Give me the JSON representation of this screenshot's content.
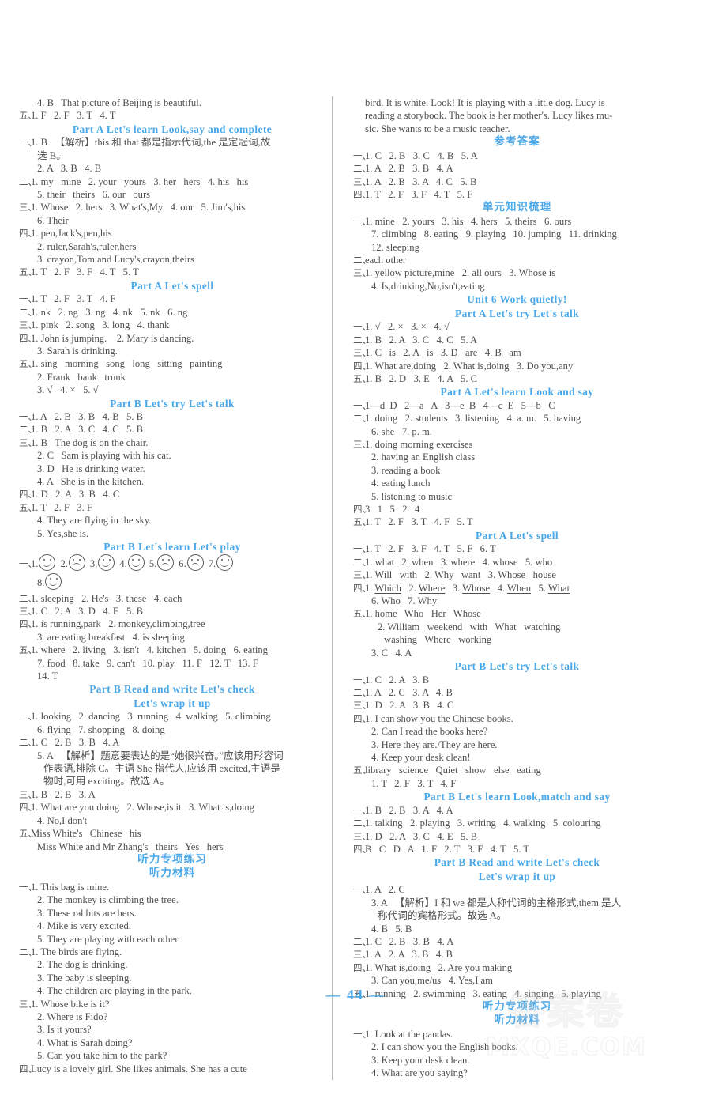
{
  "page": {
    "number": "— 44 —",
    "watermark_cn": "答案卷",
    "watermark_en": "MXQE.COM"
  },
  "left_column": [
    {
      "type": "text",
      "marker": "",
      "text": "4. B   That picture of Beijing is beautiful.",
      "indent": 1
    },
    {
      "type": "text",
      "marker": "五、",
      "text": "1. F   2. F   3. T   4. T"
    },
    {
      "type": "header",
      "text": "Part A   Let's learn   Look,say and complete"
    },
    {
      "type": "text",
      "marker": "一、",
      "text": "1. B   【解析】this 和 that 都是指示代词,the 是定冠词,故"
    },
    {
      "type": "text",
      "marker": "",
      "text": "选 B。",
      "indent": 1
    },
    {
      "type": "text",
      "marker": "",
      "text": "2. A   3. B   4. B",
      "indent": 1
    },
    {
      "type": "text",
      "marker": "二、",
      "text": "1. my   mine   2. your   yours   3. her   hers   4. his   his"
    },
    {
      "type": "text",
      "marker": "",
      "text": "5. their   theirs   6. our   ours",
      "indent": 1
    },
    {
      "type": "text",
      "marker": "三、",
      "text": "1. Whose   2. hers   3. What's,My   4. our   5. Jim's,his"
    },
    {
      "type": "text",
      "marker": "",
      "text": "6. Their",
      "indent": 1
    },
    {
      "type": "text",
      "marker": "四、",
      "text": "1. pen,Jack's,pen,his"
    },
    {
      "type": "text",
      "marker": "",
      "text": "2. ruler,Sarah's,ruler,hers",
      "indent": 1
    },
    {
      "type": "text",
      "marker": "",
      "text": "3. crayon,Tom and Lucy's,crayon,theirs",
      "indent": 1
    },
    {
      "type": "text",
      "marker": "五、",
      "text": "1. T   2. F   3. F   4. T   5. T"
    },
    {
      "type": "header",
      "text": "Part A   Let's spell"
    },
    {
      "type": "text",
      "marker": "一、",
      "text": "1. T   2. F   3. T   4. F"
    },
    {
      "type": "text",
      "marker": "二、",
      "text": "1. nk   2. ng   3. ng   4. nk   5. nk   6. ng"
    },
    {
      "type": "text",
      "marker": "三、",
      "text": "1. pink   2. song   3. long   4. thank"
    },
    {
      "type": "text",
      "marker": "四、",
      "text": "1. John is jumping.    2. Mary is dancing."
    },
    {
      "type": "text",
      "marker": "",
      "text": "3. Sarah is drinking.",
      "indent": 1
    },
    {
      "type": "text",
      "marker": "五、",
      "text": "1. sing   morning   song   long   sitting   painting"
    },
    {
      "type": "text",
      "marker": "",
      "text": "2. Frank   bank   trunk",
      "indent": 1
    },
    {
      "type": "text",
      "marker": "",
      "text": "3. √   4. ×   5. √",
      "indent": 1
    },
    {
      "type": "header",
      "text": "Part B   Let's try   Let's talk"
    },
    {
      "type": "text",
      "marker": "一、",
      "text": "1. A   2. B   3. B   4. B   5. B"
    },
    {
      "type": "text",
      "marker": "二、",
      "text": "1. B   2. A   3. C   4. C   5. B"
    },
    {
      "type": "text",
      "marker": "三、",
      "text": "1. B   The dog is on the chair."
    },
    {
      "type": "text",
      "marker": "",
      "text": "2. C   Sam is playing with his cat.",
      "indent": 1
    },
    {
      "type": "text",
      "marker": "",
      "text": "3. D   He is drinking water.",
      "indent": 1
    },
    {
      "type": "text",
      "marker": "",
      "text": "4. A   She is in the kitchen.",
      "indent": 1
    },
    {
      "type": "text",
      "marker": "四、",
      "text": "1. D   2. A   3. B   4. C"
    },
    {
      "type": "text",
      "marker": "五、",
      "text": "1. T   2. F   3. F"
    },
    {
      "type": "text",
      "marker": "",
      "text": "4. They are flying in the sky.",
      "indent": 1
    },
    {
      "type": "text",
      "marker": "",
      "text": "5. Yes,she is.",
      "indent": 1
    },
    {
      "type": "header",
      "text": "Part B   Let's learn   Let's play"
    },
    {
      "type": "faces",
      "marker": "一、",
      "items": [
        {
          "n": "1.",
          "mood": "happy"
        },
        {
          "n": "2.",
          "mood": "sad"
        },
        {
          "n": "3.",
          "mood": "happy"
        },
        {
          "n": "4.",
          "mood": "happy"
        },
        {
          "n": "5.",
          "mood": "sad"
        },
        {
          "n": "6.",
          "mood": "sad"
        },
        {
          "n": "7.",
          "mood": "happy"
        }
      ]
    },
    {
      "type": "faces",
      "marker": "",
      "indent": 1,
      "items": [
        {
          "n": "8.",
          "mood": "happy"
        }
      ]
    },
    {
      "type": "text",
      "marker": "二、",
      "text": "1. sleeping   2. He's   3. these   4. each"
    },
    {
      "type": "text",
      "marker": "三、",
      "text": "1. C   2. A   3. D   4. E   5. B"
    },
    {
      "type": "text",
      "marker": "四、",
      "text": "1. is running,park   2. monkey,climbing,tree"
    },
    {
      "type": "text",
      "marker": "",
      "text": "3. are eating breakfast   4. is sleeping",
      "indent": 1
    },
    {
      "type": "text",
      "marker": "五、",
      "text": "1. where   2. living   3. isn't   4. kitchen   5. doing   6. eating"
    },
    {
      "type": "text",
      "marker": "",
      "text": "7. food   8. take   9. can't   10. play   11. F   12. T   13. F",
      "indent": 1
    },
    {
      "type": "text",
      "marker": "",
      "text": "14. T",
      "indent": 1
    },
    {
      "type": "header",
      "text": "Part B   Read and write   Let's check"
    },
    {
      "type": "header",
      "text": "Let's wrap it up"
    },
    {
      "type": "text",
      "marker": "一、",
      "text": "1. looking   2. dancing   3. running   4. walking   5. climbing"
    },
    {
      "type": "text",
      "marker": "",
      "text": "6. flying   7. shopping   8. doing",
      "indent": 1
    },
    {
      "type": "text",
      "marker": "二、",
      "text": "1. C   2. B   3. B   4. A"
    },
    {
      "type": "text",
      "marker": "",
      "text": "5. A   【解析】题意要表达的是“她很兴奋。”应该用形容词",
      "indent": 1
    },
    {
      "type": "text",
      "marker": "",
      "text": "作表语,排除 C。主语 She 指代人,应该用 excited,主语是",
      "indent": 2
    },
    {
      "type": "text",
      "marker": "",
      "text": "物时,可用 exciting。故选 A。",
      "indent": 2
    },
    {
      "type": "text",
      "marker": "三、",
      "text": "1. B   2. B   3. A"
    },
    {
      "type": "text",
      "marker": "四、",
      "text": "1. What are you doing   2. Whose,is it   3. What is,doing"
    },
    {
      "type": "text",
      "marker": "",
      "text": "4. No,I don't",
      "indent": 1
    },
    {
      "type": "text",
      "marker": "五、",
      "text": "Miss White's   Chinese   his"
    },
    {
      "type": "text",
      "marker": "",
      "text": "Miss White and Mr Zhang's   theirs   Yes   hers",
      "indent": 1
    },
    {
      "type": "header",
      "cn": true,
      "text": "听力专项练习"
    },
    {
      "type": "header",
      "cn": true,
      "text": "听力材料"
    },
    {
      "type": "text",
      "marker": "一、",
      "text": "1. This bag is mine."
    },
    {
      "type": "text",
      "marker": "",
      "text": "2. The monkey is climbing the tree.",
      "indent": 1
    },
    {
      "type": "text",
      "marker": "",
      "text": "3. These rabbits are hers.",
      "indent": 1
    },
    {
      "type": "text",
      "marker": "",
      "text": "4. Mike is very excited.",
      "indent": 1
    },
    {
      "type": "text",
      "marker": "",
      "text": "5. They are playing with each other.",
      "indent": 1
    },
    {
      "type": "text",
      "marker": "二、",
      "text": "1. The birds are flying."
    },
    {
      "type": "text",
      "marker": "",
      "text": "2. The dog is drinking.",
      "indent": 1
    },
    {
      "type": "text",
      "marker": "",
      "text": "3. The baby is sleeping.",
      "indent": 1
    },
    {
      "type": "text",
      "marker": "",
      "text": "4. The children are playing in the park.",
      "indent": 1
    },
    {
      "type": "text",
      "marker": "三、",
      "text": "1. Whose bike is it?"
    },
    {
      "type": "text",
      "marker": "",
      "text": "2. Where is Fido?",
      "indent": 1
    },
    {
      "type": "text",
      "marker": "",
      "text": "3. Is it yours?",
      "indent": 1
    },
    {
      "type": "text",
      "marker": "",
      "text": "4. What is Sarah doing?",
      "indent": 1
    },
    {
      "type": "text",
      "marker": "",
      "text": "5. Can you take him to the park?",
      "indent": 1
    },
    {
      "type": "para",
      "marker": "四、",
      "text": "Lucy is a lovely girl. She likes animals. She has a cute"
    }
  ],
  "right_column": [
    {
      "type": "text",
      "marker": "",
      "text": "bird. It is white. Look! It is playing with a little dog. Lucy is"
    },
    {
      "type": "text",
      "marker": "",
      "text": "reading a storybook. The book is her mother's. Lucy likes mu-"
    },
    {
      "type": "text",
      "marker": "",
      "text": "sic. She wants to be a music teacher."
    },
    {
      "type": "header",
      "cn": true,
      "text": "参考答案"
    },
    {
      "type": "text",
      "marker": "一、",
      "text": "1. C   2. B   3. C   4. B   5. A"
    },
    {
      "type": "text",
      "marker": "二、",
      "text": "1. A   2. B   3. B   4. A"
    },
    {
      "type": "text",
      "marker": "三、",
      "text": "1. A   2. B   3. A   4. C   5. B"
    },
    {
      "type": "text",
      "marker": "四、",
      "text": "1. T   2. F   3. F   4. T   5. F"
    },
    {
      "type": "header",
      "cn": true,
      "text": "单元知识梳理"
    },
    {
      "type": "text",
      "marker": "一、",
      "text": "1. mine   2. yours   3. his   4. hers   5. theirs   6. ours"
    },
    {
      "type": "text",
      "marker": "",
      "text": "7. climbing   8. eating   9. playing   10. jumping   11. drinking",
      "indent": 1
    },
    {
      "type": "text",
      "marker": "",
      "text": "12. sleeping",
      "indent": 1
    },
    {
      "type": "text",
      "marker": "二、",
      "text": "each other"
    },
    {
      "type": "text",
      "marker": "三、",
      "text": "1. yellow picture,mine   2. all ours   3. Whose is"
    },
    {
      "type": "text",
      "marker": "",
      "text": "4. Is,drinking,No,isn't,eating",
      "indent": 1
    },
    {
      "type": "header",
      "text": "Unit 6   Work quietly!"
    },
    {
      "type": "header",
      "text": "Part A   Let's try   Let's talk"
    },
    {
      "type": "text",
      "marker": "一、",
      "text": "1. √   2. ×   3. ×   4. √"
    },
    {
      "type": "text",
      "marker": "二、",
      "text": "1. B   2. A   3. C   4. C   5. A"
    },
    {
      "type": "text",
      "marker": "三、",
      "text": "1. C   is   2. A   is   3. D   are   4. B   am"
    },
    {
      "type": "text",
      "marker": "四、",
      "text": "1. What are,doing   2. What is,doing   3. Do you,any"
    },
    {
      "type": "text",
      "marker": "五、",
      "text": "1. B   2. D   3. E   4. A   5. C"
    },
    {
      "type": "header",
      "text": "Part A   Let's learn   Look and say"
    },
    {
      "type": "text",
      "marker": "一、",
      "text": "1—d  D   2—a   A   3—e  B   4—c  E   5—b   C"
    },
    {
      "type": "text",
      "marker": "二、",
      "text": "1. doing   2. students   3. listening   4. a. m.   5. having"
    },
    {
      "type": "text",
      "marker": "",
      "text": "6. she   7. p. m.",
      "indent": 1
    },
    {
      "type": "text",
      "marker": "三、",
      "text": "1. doing morning exercises"
    },
    {
      "type": "text",
      "marker": "",
      "text": "2. having an English class",
      "indent": 1
    },
    {
      "type": "text",
      "marker": "",
      "text": "3. reading a book",
      "indent": 1
    },
    {
      "type": "text",
      "marker": "",
      "text": "4. eating lunch",
      "indent": 1
    },
    {
      "type": "text",
      "marker": "",
      "text": "5. listening to music",
      "indent": 1
    },
    {
      "type": "text",
      "marker": "四、",
      "text": "3   1   5   2   4"
    },
    {
      "type": "text",
      "marker": "五、",
      "text": "1. T   2. F   3. T   4. F   5. T"
    },
    {
      "type": "header",
      "text": "Part A   Let's spell"
    },
    {
      "type": "text",
      "marker": "一、",
      "text": "1. T   2. F   3. F   4. T   5. F   6. T"
    },
    {
      "type": "text",
      "marker": "二、",
      "text": "1. what   2. when   3. where   4. whose   5. who"
    },
    {
      "type": "html",
      "marker": "三、",
      "text": "1. <u>Will</u>   <u>with</u>   2. <u>Why</u>   <u>want</u>   3. <u>Whose</u>   <u>house</u>"
    },
    {
      "type": "html",
      "marker": "四、",
      "text": "1. <u>Which</u>   2. <u>Where</u>   3. <u>Whose</u>   4. <u>When</u>   5. <u>What</u>"
    },
    {
      "type": "html",
      "marker": "",
      "text": "6. <u>Who</u>   7. <u>Why</u>",
      "indent": 1
    },
    {
      "type": "text",
      "marker": "五、",
      "text": "1. home   Who   Her   Whose"
    },
    {
      "type": "text",
      "marker": "",
      "text": "2. William   weekend   with   What   watching",
      "indent": 2
    },
    {
      "type": "text",
      "marker": "",
      "text": "washing   Where   working",
      "indent": 3
    },
    {
      "type": "text",
      "marker": "",
      "text": "3. C   4. A",
      "indent": 1
    },
    {
      "type": "header",
      "text": "Part B   Let's try   Let's talk"
    },
    {
      "type": "text",
      "marker": "一、",
      "text": "1. C   2. A   3. B"
    },
    {
      "type": "text",
      "marker": "二、",
      "text": "1. A   2. C   3. A   4. B"
    },
    {
      "type": "text",
      "marker": "三、",
      "text": "1. D   2. A   3. B   4. C"
    },
    {
      "type": "text",
      "marker": "四、",
      "text": "1. I can show you the Chinese books."
    },
    {
      "type": "text",
      "marker": "",
      "text": "2. Can I read the books here?",
      "indent": 1
    },
    {
      "type": "text",
      "marker": "",
      "text": "3. Here they are./They are here.",
      "indent": 1
    },
    {
      "type": "text",
      "marker": "",
      "text": "4. Keep your desk clean!",
      "indent": 1
    },
    {
      "type": "text",
      "marker": "五、",
      "text": "library   science   Quiet   show   else   eating"
    },
    {
      "type": "text",
      "marker": "",
      "text": "1. T   2. F   3. T   4. F",
      "indent": 1
    },
    {
      "type": "header",
      "text": "Part B   Let's learn   Look,match and say"
    },
    {
      "type": "text",
      "marker": "一、",
      "text": "1. B   2. B   3. A   4. A"
    },
    {
      "type": "text",
      "marker": "二、",
      "text": "1. talking   2. playing   3. writing   4. walking   5. colouring"
    },
    {
      "type": "text",
      "marker": "三、",
      "text": "1. D   2. A   3. C   4. E   5. B"
    },
    {
      "type": "text",
      "marker": "四、",
      "text": "B   C   D   A   1. F   2. T   3. F   4. T   5. T"
    },
    {
      "type": "header",
      "text": "Part B   Read and write   Let's check"
    },
    {
      "type": "header",
      "text": "Let's wrap it up"
    },
    {
      "type": "text",
      "marker": "一、",
      "text": "1. A   2. C"
    },
    {
      "type": "text",
      "marker": "",
      "text": "3. A   【解析】I 和 we 都是人称代词的主格形式,them 是人",
      "indent": 1
    },
    {
      "type": "text",
      "marker": "",
      "text": "称代词的宾格形式。故选 A。",
      "indent": 2
    },
    {
      "type": "text",
      "marker": "",
      "text": "4. B   5. B",
      "indent": 1
    },
    {
      "type": "text",
      "marker": "二、",
      "text": "1. C   2. B   3. B   4. A"
    },
    {
      "type": "text",
      "marker": "三、",
      "text": "1. A   2. A   3. B   4. B"
    },
    {
      "type": "text",
      "marker": "四、",
      "text": "1. What is,doing   2. Are you making"
    },
    {
      "type": "text",
      "marker": "",
      "text": "3. Can you,me/us   4. Yes,I am",
      "indent": 1
    },
    {
      "type": "text",
      "marker": "五、",
      "text": "1. running   2. swimming   3. eating   4. singing   5. playing"
    },
    {
      "type": "header",
      "cn": true,
      "text": "听力专项练习"
    },
    {
      "type": "header",
      "cn": true,
      "text": "听力材料"
    },
    {
      "type": "text",
      "marker": "一、",
      "text": "1. Look at the pandas."
    },
    {
      "type": "text",
      "marker": "",
      "text": "2. I can show you the English books.",
      "indent": 1
    },
    {
      "type": "text",
      "marker": "",
      "text": "3. Keep your desk clean.",
      "indent": 1
    },
    {
      "type": "text",
      "marker": "",
      "text": "4. What are you saying?",
      "indent": 1
    }
  ]
}
